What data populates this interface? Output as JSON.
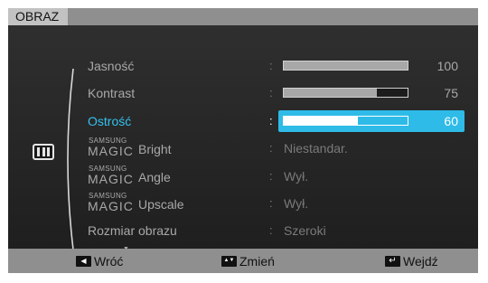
{
  "header": {
    "title": "OBRAZ"
  },
  "menu": {
    "icon": "picture-menu-icon",
    "brand_small": "SAMSUNG",
    "brand_magic": "MAGIC",
    "items": [
      {
        "label": "Jasność",
        "colon": ":",
        "value": 100,
        "value_text": "100",
        "max": 100
      },
      {
        "label": "Kontrast",
        "colon": ":",
        "value": 75,
        "value_text": "75",
        "max": 100
      },
      {
        "label": "Ostrość",
        "colon": ":",
        "value": 60,
        "value_text": "60",
        "max": 100
      },
      {
        "label": "Bright",
        "colon": ":",
        "value_text": "Niestandar."
      },
      {
        "label": "Angle",
        "colon": ":",
        "value_text": "Wył."
      },
      {
        "label": "Upscale",
        "colon": ":",
        "value_text": "Wył."
      },
      {
        "label": "Rozmiar obrazu",
        "colon": ":",
        "value_text": "Szeroki"
      }
    ],
    "more_indicator": "▼"
  },
  "footer": {
    "back": {
      "label": "Wróć",
      "icon": "left-arrow-key-icon",
      "glyph": "◀"
    },
    "change": {
      "label": "Zmień",
      "icon": "up-down-arrow-key-icon",
      "glyph": "▲▼"
    },
    "enter": {
      "label": "Wejdź",
      "icon": "enter-key-icon",
      "glyph": "↵"
    }
  },
  "colors": {
    "highlight": "#2ebbe8",
    "selected_text": "#33c2ee",
    "bar_fill": "#a8a8a8",
    "title_bg": "#8f8f8f",
    "panel_bg": "#1c1c1c"
  }
}
